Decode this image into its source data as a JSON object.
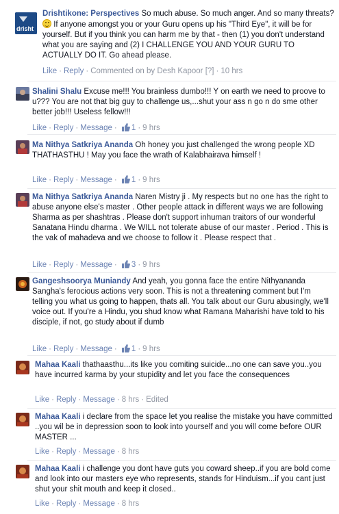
{
  "colors": {
    "link": "#3b5998",
    "meta": "#9197a3",
    "action": "#6d84b4"
  },
  "comments": [
    {
      "author": "Drishtikone: Perspectives",
      "text_before": " So much abuse. So much anger. And so many threats? ",
      "text_after": " If anyone amongst you or your Guru opens up his \"Third Eye\", it will be for yourself. But if you think you can harm me by that - then (1) you don't understand what you are saying and (2) I CHALLENGE YOU AND YOUR GURU TO ACTUALLY DO IT. Go ahead please.",
      "like": "Like",
      "reply": "Reply",
      "commented_on": "Commented on by Desh Kapoor",
      "help": "[?]",
      "time": "10 hrs",
      "avatar_text": "drisht"
    },
    {
      "author": "Shalini Shalu",
      "text": " Excuse me!!! You brainless dumbo!!! Y on earth we need to proove to u??? You are not that big guy to challenge us,...shut your ass n go n do sme other better job!!! Useless fellow!!!",
      "like": "Like",
      "reply": "Reply",
      "message": "Message",
      "likes": "1",
      "time": "9 hrs"
    },
    {
      "author": "Ma Nithya Satkriya Ananda",
      "text": " Oh honey you just challenged the wrong people XD THATHASTHU ! May you face the wrath of Kalabhairava himself !",
      "like": "Like",
      "reply": "Reply",
      "message": "Message",
      "likes": "1",
      "time": "9 hrs"
    },
    {
      "author": "Ma Nithya Satkriya Ananda",
      "text": " Naren Mistry ji . My respects but no one has the right to abuse anyone else's master . Other people attack in different ways we are following Sharma as per shashtras . Please don't support inhuman traitors of our wonderful Sanatana Hindu dharma . We WILL not tolerate abuse of our master . Period . This is the vak of mahadeva and we choose to follow it . Please respect that .",
      "like": "Like",
      "reply": "Reply",
      "message": "Message",
      "likes": "3",
      "time": "9 hrs"
    },
    {
      "author": "Gangeshsoorya Muniandy",
      "text": " And yeah, you gonna face the entire Nithyananda Sangha's ferocious actions very soon. This is not a threatening comment but I'm telling you what us going to happen, thats all. You talk about our Guru abusingly, we'll voice out. If you're a Hindu, you shud know what Ramana Maharishi have told to his disciple, if not, go study about if dumb",
      "like": "Like",
      "reply": "Reply",
      "message": "Message",
      "likes": "1",
      "time": "9 hrs"
    },
    {
      "author": "Mahaa Kaali",
      "text": " thathaasthu...its like you comiting suicide...no one can save you..you have incurred karma by your stupidity and let you face the consequences",
      "like": "Like",
      "reply": "Reply",
      "message": "Message",
      "time": "8 hrs",
      "edited": "Edited"
    },
    {
      "author": "Mahaa Kaali",
      "text": " i declare from the space let you realise the mistake you have committed ..you wil be in depression soon to look into yourself and you will come before OUR MASTER ...",
      "like": "Like",
      "reply": "Reply",
      "message": "Message",
      "time": "8 hrs"
    },
    {
      "author": "Mahaa Kaali",
      "text": " i challenge you dont have guts you coward sheep..if you are bold come and look into our masters eye who represents, stands for Hinduism...if you cant just shut your shit mouth and keep it closed..",
      "like": "Like",
      "reply": "Reply",
      "message": "Message",
      "time": "8 hrs"
    }
  ]
}
